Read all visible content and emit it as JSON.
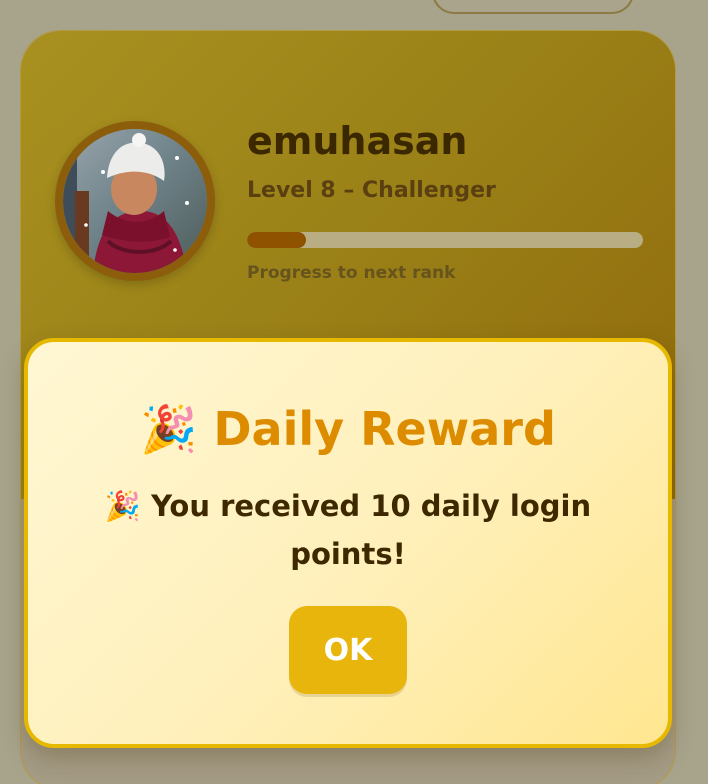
{
  "profile": {
    "username": "emuhasan",
    "level_text": "Level 8 – Challenger",
    "progress_percent": 15,
    "progress_caption": "Progress to next rank"
  },
  "modal": {
    "title": "🎉 Daily Reward",
    "message": "🎉 You received 10 daily login points!",
    "ok_label": "OK"
  },
  "colors": {
    "header_gold": "#9b8218",
    "modal_gold": "#e6b800",
    "title_orange": "#dd8c00",
    "button_gold": "#e8b50d"
  },
  "icons": {
    "avatar": "user-photo-icon",
    "celebration": "party-popper-icon"
  }
}
